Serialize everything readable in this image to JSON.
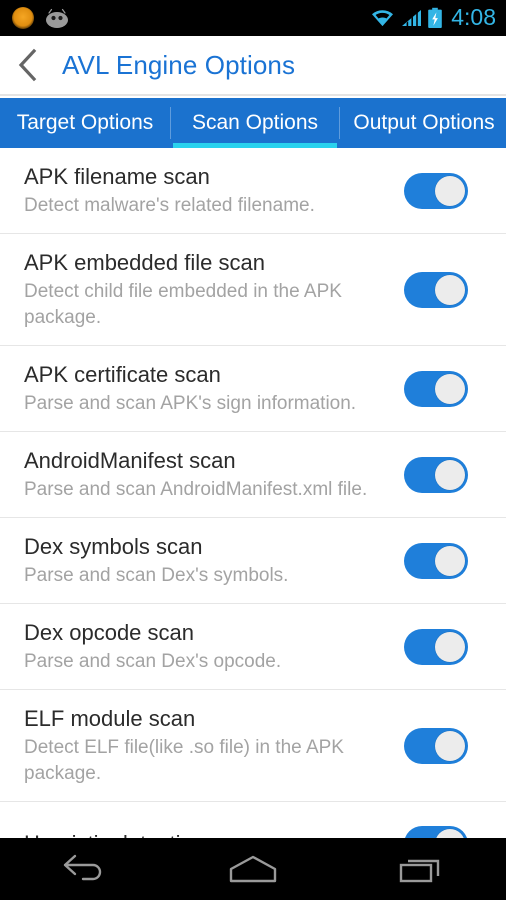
{
  "status_bar": {
    "time": "4:08",
    "notification_icons": [
      "notification-dot-icon",
      "android-head-icon"
    ],
    "system_icons": [
      "wifi-icon",
      "cellular-signal-icon",
      "battery-charging-icon"
    ],
    "clock_color": "#33b5e5",
    "background": "#000000"
  },
  "action_bar": {
    "back_icon": "back-chevron-icon",
    "title": "AVL Engine Options",
    "title_color": "#1a73d4"
  },
  "tab_bar": {
    "background": "#1b72ce",
    "indicator_color": "#29d2ee",
    "active_index": 1,
    "tabs": [
      {
        "label": "Target Options"
      },
      {
        "label": "Scan Options"
      },
      {
        "label": "Output Options"
      }
    ]
  },
  "options": [
    {
      "title": "APK filename scan",
      "subtitle": "Detect malware's related filename.",
      "toggle": "on"
    },
    {
      "title": "APK embedded file scan",
      "subtitle": "Detect child file embedded in the APK package.",
      "toggle": "on"
    },
    {
      "title": "APK certificate scan",
      "subtitle": "Parse and scan APK's sign information.",
      "toggle": "on"
    },
    {
      "title": "AndroidManifest scan",
      "subtitle": "Parse and scan AndroidManifest.xml file.",
      "toggle": "on"
    },
    {
      "title": "Dex symbols scan",
      "subtitle": "Parse and scan Dex's symbols.",
      "toggle": "on"
    },
    {
      "title": "Dex opcode scan",
      "subtitle": "Parse and scan Dex's opcode.",
      "toggle": "on"
    },
    {
      "title": "ELF module scan",
      "subtitle": "Detect ELF file(like .so file) in the APK package.",
      "toggle": "on"
    },
    {
      "title": "Heuristic detection",
      "subtitle": "",
      "toggle": "on"
    }
  ],
  "nav_bar": {
    "buttons": [
      "back-nav-icon",
      "home-nav-icon",
      "recents-nav-icon"
    ],
    "background": "#000000"
  }
}
